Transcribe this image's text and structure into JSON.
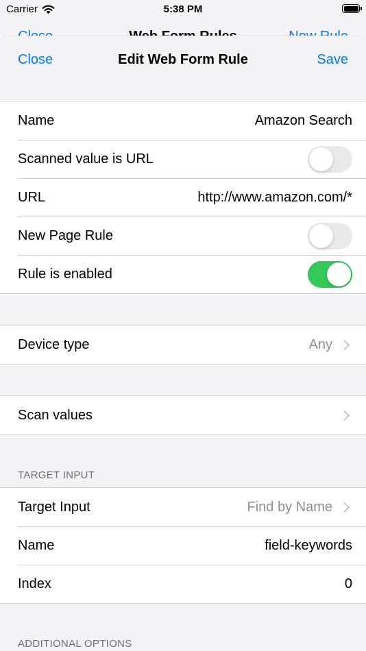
{
  "status_bar": {
    "carrier": "Carrier",
    "time": "5:38 PM"
  },
  "background_nav": {
    "left": "Close",
    "title": "Web Form Rules",
    "right": "New Rule"
  },
  "nav": {
    "close_label": "Close",
    "title": "Edit Web Form Rule",
    "save_label": "Save"
  },
  "rule_group": {
    "name_label": "Name",
    "name_value": "Amazon Search",
    "scanned_url_label": "Scanned value is URL",
    "scanned_url_on": false,
    "url_label": "URL",
    "url_value": "http://www.amazon.com/*",
    "new_page_label": "New Page Rule",
    "new_page_on": false,
    "enabled_label": "Rule is enabled",
    "enabled_on": true
  },
  "device_group": {
    "label": "Device type",
    "value": "Any"
  },
  "scan_group": {
    "label": "Scan values"
  },
  "target_section": {
    "header": "TARGET INPUT",
    "target_label": "Target Input",
    "target_value": "Find by Name",
    "name_label": "Name",
    "name_value": "field-keywords",
    "index_label": "Index",
    "index_value": "0"
  },
  "additional_section": {
    "header": "ADDITIONAL OPTIONS"
  },
  "colors": {
    "accent": "#007aff",
    "toggle_on": "#34c759",
    "toggle_off": "#e9e9ea",
    "background": "#f2f2f7"
  }
}
